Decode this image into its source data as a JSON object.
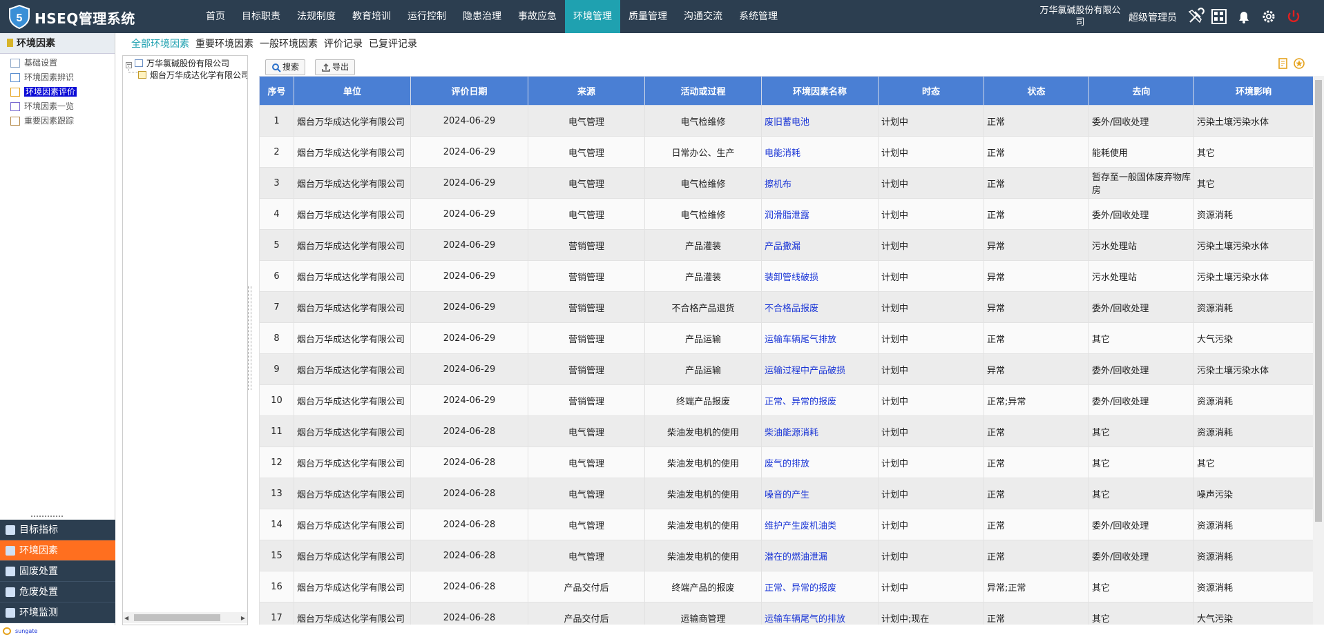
{
  "app": {
    "title": "HSEQ管理系统",
    "company": "万华氯碱股份有限公司",
    "user": "超级管理员"
  },
  "nav": [
    "首页",
    "目标职责",
    "法规制度",
    "教育培训",
    "运行控制",
    "隐患治理",
    "事故应急",
    "环境管理",
    "质量管理",
    "沟通交流",
    "系统管理"
  ],
  "nav_active": 7,
  "icons": [
    "tools-icon",
    "grid-icon",
    "bell-icon",
    "gear-icon",
    "power-icon"
  ],
  "left": {
    "header": "环境因素",
    "items": [
      "基础设置",
      "环境因素辨识",
      "环境因素评价",
      "环境因素一览",
      "重要因素跟踪"
    ],
    "selected": 2
  },
  "bottom_menu": [
    "目标指标",
    "环境因素",
    "固废处置",
    "危废处置",
    "环境监测"
  ],
  "bottom_active": 1,
  "footer": "sungate",
  "subtabs": [
    "全部环境因素",
    "重要环境因素",
    "一般环境因素",
    "评价记录",
    "已复评记录"
  ],
  "tree": {
    "root": "万华氯碱股份有限公司",
    "child": "烟台万华成达化学有限公司"
  },
  "toolbar": {
    "search": "搜索",
    "export": "导出"
  },
  "columns": [
    "序号",
    "单位",
    "评价日期",
    "来源",
    "活动或过程",
    "环境因素名称",
    "时态",
    "状态",
    "去向",
    "环境影响"
  ],
  "rows": [
    [
      "1",
      "烟台万华成达化学有限公司",
      "2024-06-29",
      "电气管理",
      "电气检维修",
      "废旧蓄电池",
      "计划中",
      "正常",
      "委外/回收处理",
      "污染土壤污染水体"
    ],
    [
      "2",
      "烟台万华成达化学有限公司",
      "2024-06-29",
      "电气管理",
      "日常办公、生产",
      "电能消耗",
      "计划中",
      "正常",
      "能耗使用",
      "其它"
    ],
    [
      "3",
      "烟台万华成达化学有限公司",
      "2024-06-29",
      "电气管理",
      "电气检维修",
      "擦机布",
      "计划中",
      "正常",
      "暂存至一般固体废弃物库房",
      "其它"
    ],
    [
      "4",
      "烟台万华成达化学有限公司",
      "2024-06-29",
      "电气管理",
      "电气检维修",
      "润滑脂泄露",
      "计划中",
      "正常",
      "委外/回收处理",
      "资源消耗"
    ],
    [
      "5",
      "烟台万华成达化学有限公司",
      "2024-06-29",
      "营销管理",
      "产品灌装",
      "产品撒漏",
      "计划中",
      "异常",
      "污水处理站",
      "污染土壤污染水体"
    ],
    [
      "6",
      "烟台万华成达化学有限公司",
      "2024-06-29",
      "营销管理",
      "产品灌装",
      "装卸管线破损",
      "计划中",
      "异常",
      "污水处理站",
      "污染土壤污染水体"
    ],
    [
      "7",
      "烟台万华成达化学有限公司",
      "2024-06-29",
      "营销管理",
      "不合格产品退货",
      "不合格品报废",
      "计划中",
      "异常",
      "委外/回收处理",
      "资源消耗"
    ],
    [
      "8",
      "烟台万华成达化学有限公司",
      "2024-06-29",
      "营销管理",
      "产品运输",
      "运输车辆尾气排放",
      "计划中",
      "正常",
      "其它",
      "大气污染"
    ],
    [
      "9",
      "烟台万华成达化学有限公司",
      "2024-06-29",
      "营销管理",
      "产品运输",
      "运输过程中产品破损",
      "计划中",
      "异常",
      "委外/回收处理",
      "污染土壤污染水体"
    ],
    [
      "10",
      "烟台万华成达化学有限公司",
      "2024-06-29",
      "营销管理",
      "终端产品报废",
      "正常、异常的报废",
      "计划中",
      "正常;异常",
      "委外/回收处理",
      "资源消耗"
    ],
    [
      "11",
      "烟台万华成达化学有限公司",
      "2024-06-28",
      "电气管理",
      "柴油发电机的使用",
      "柴油能源消耗",
      "计划中",
      "正常",
      "其它",
      "资源消耗"
    ],
    [
      "12",
      "烟台万华成达化学有限公司",
      "2024-06-28",
      "电气管理",
      "柴油发电机的使用",
      "废气的排放",
      "计划中",
      "正常",
      "其它",
      "其它"
    ],
    [
      "13",
      "烟台万华成达化学有限公司",
      "2024-06-28",
      "电气管理",
      "柴油发电机的使用",
      "噪音的产生",
      "计划中",
      "正常",
      "其它",
      "噪声污染"
    ],
    [
      "14",
      "烟台万华成达化学有限公司",
      "2024-06-28",
      "电气管理",
      "柴油发电机的使用",
      "维护产生废机油类",
      "计划中",
      "正常",
      "委外/回收处理",
      "资源消耗"
    ],
    [
      "15",
      "烟台万华成达化学有限公司",
      "2024-06-28",
      "电气管理",
      "柴油发电机的使用",
      "潜在的燃油泄漏",
      "计划中",
      "正常",
      "委外/回收处理",
      "资源消耗"
    ],
    [
      "16",
      "烟台万华成达化学有限公司",
      "2024-06-28",
      "产品交付后",
      "终端产品的报废",
      "正常、异常的报废",
      "计划中",
      "异常;正常",
      "其它",
      "资源消耗"
    ],
    [
      "17",
      "烟台万华成达化学有限公司",
      "2024-06-28",
      "产品交付后",
      "运输商管理",
      "运输车辆尾气的排放",
      "计划中;现在",
      "正常",
      "其它",
      "大气污染"
    ]
  ]
}
